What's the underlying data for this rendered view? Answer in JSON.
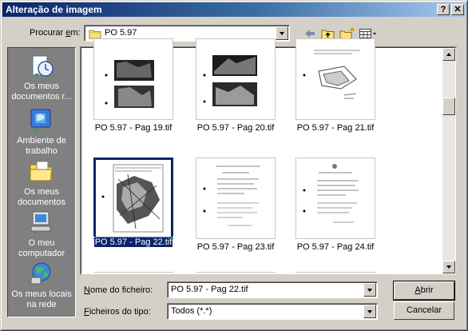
{
  "window": {
    "title": "Alteração de imagem",
    "help_label": "?",
    "close_label": "✕"
  },
  "lookin": {
    "label_prefix": "Procurar ",
    "label_accel": "e",
    "label_suffix": "m:",
    "value": "PO 5.97"
  },
  "places": [
    {
      "icon": "my-recent-documents-icon",
      "label": "Os meus documentos r..."
    },
    {
      "icon": "desktop-icon",
      "label": "Ambiente de trabalho"
    },
    {
      "icon": "my-documents-icon",
      "label": "Os meus documentos"
    },
    {
      "icon": "my-computer-icon",
      "label": "O meu computador"
    },
    {
      "icon": "my-network-places-icon",
      "label": "Os meus locais na rede"
    }
  ],
  "files": [
    {
      "name": "PO 5.97 - Pag 19.tif",
      "selected": false
    },
    {
      "name": "PO 5.97 - Pag 20.tif",
      "selected": false
    },
    {
      "name": "PO 5.97 - Pag 21.tif",
      "selected": false
    },
    {
      "name": "PO 5.97 - Pag 22.tif",
      "selected": true
    },
    {
      "name": "PO 5.97 - Pag 23.tif",
      "selected": false
    },
    {
      "name": "PO 5.97 - Pag 24.tif",
      "selected": false
    }
  ],
  "filename": {
    "label_accel": "N",
    "label_rest": "ome do ficheiro:",
    "value": "PO 5.97 - Pag 22.tif"
  },
  "filetype": {
    "label_accel": "F",
    "label_rest": "icheiros do tipo:",
    "value": "Todos (*.*)"
  },
  "buttons": {
    "open_accel": "A",
    "open_rest": "brir",
    "cancel": "Cancelar"
  },
  "colors": {
    "titlebar": "#0a246a",
    "selection": "#0a246a",
    "face": "#d4d0c8"
  }
}
